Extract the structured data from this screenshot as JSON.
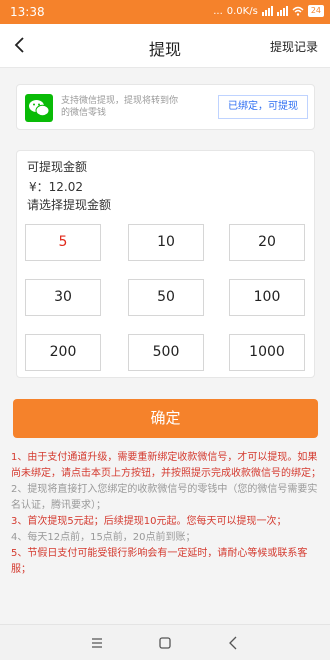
{
  "statusbar": {
    "time": "13:38",
    "dots": "...",
    "speed": "0.0K/s",
    "battery": "24"
  },
  "navbar": {
    "title": "提现",
    "record_link": "提现记录",
    "back_icon": "chevron-left-icon"
  },
  "bind": {
    "icon": "wechat-icon",
    "desc": "支持微信提现，提现将转到你的微信零钱",
    "button": "已绑定，可提现"
  },
  "amount": {
    "available_label": "可提现金额",
    "balance": "¥：12.02",
    "choose_label": "请选择提现金额",
    "options": [
      "5",
      "10",
      "20",
      "30",
      "50",
      "100",
      "200",
      "500",
      "1000"
    ],
    "selected": "5"
  },
  "confirm_button": "确定",
  "notes": {
    "n1": "1、由于支付通道升级，需要重新绑定收款微信号，才可以提现。如果尚未绑定，请点击本页上方按钮，并按照提示完成收款微信号的绑定；",
    "n2": "2、提现将直接打入您绑定的收款微信号的零钱中（您的微信号需要实名认证，腾讯要求）；",
    "n3": "3、首次提现5元起；后续提现10元起。您每天可以提现一次；",
    "n4": "4、每天12点前，15点前，20点前到账；",
    "n5": "5、节假日支付可能受银行影响会有一定延时，请耐心等候或联系客服；"
  },
  "colors": {
    "accent": "#f5822b",
    "note_red": "#d43a2f",
    "link_blue": "#2f6ff2",
    "wechat_green": "#09bb07"
  }
}
